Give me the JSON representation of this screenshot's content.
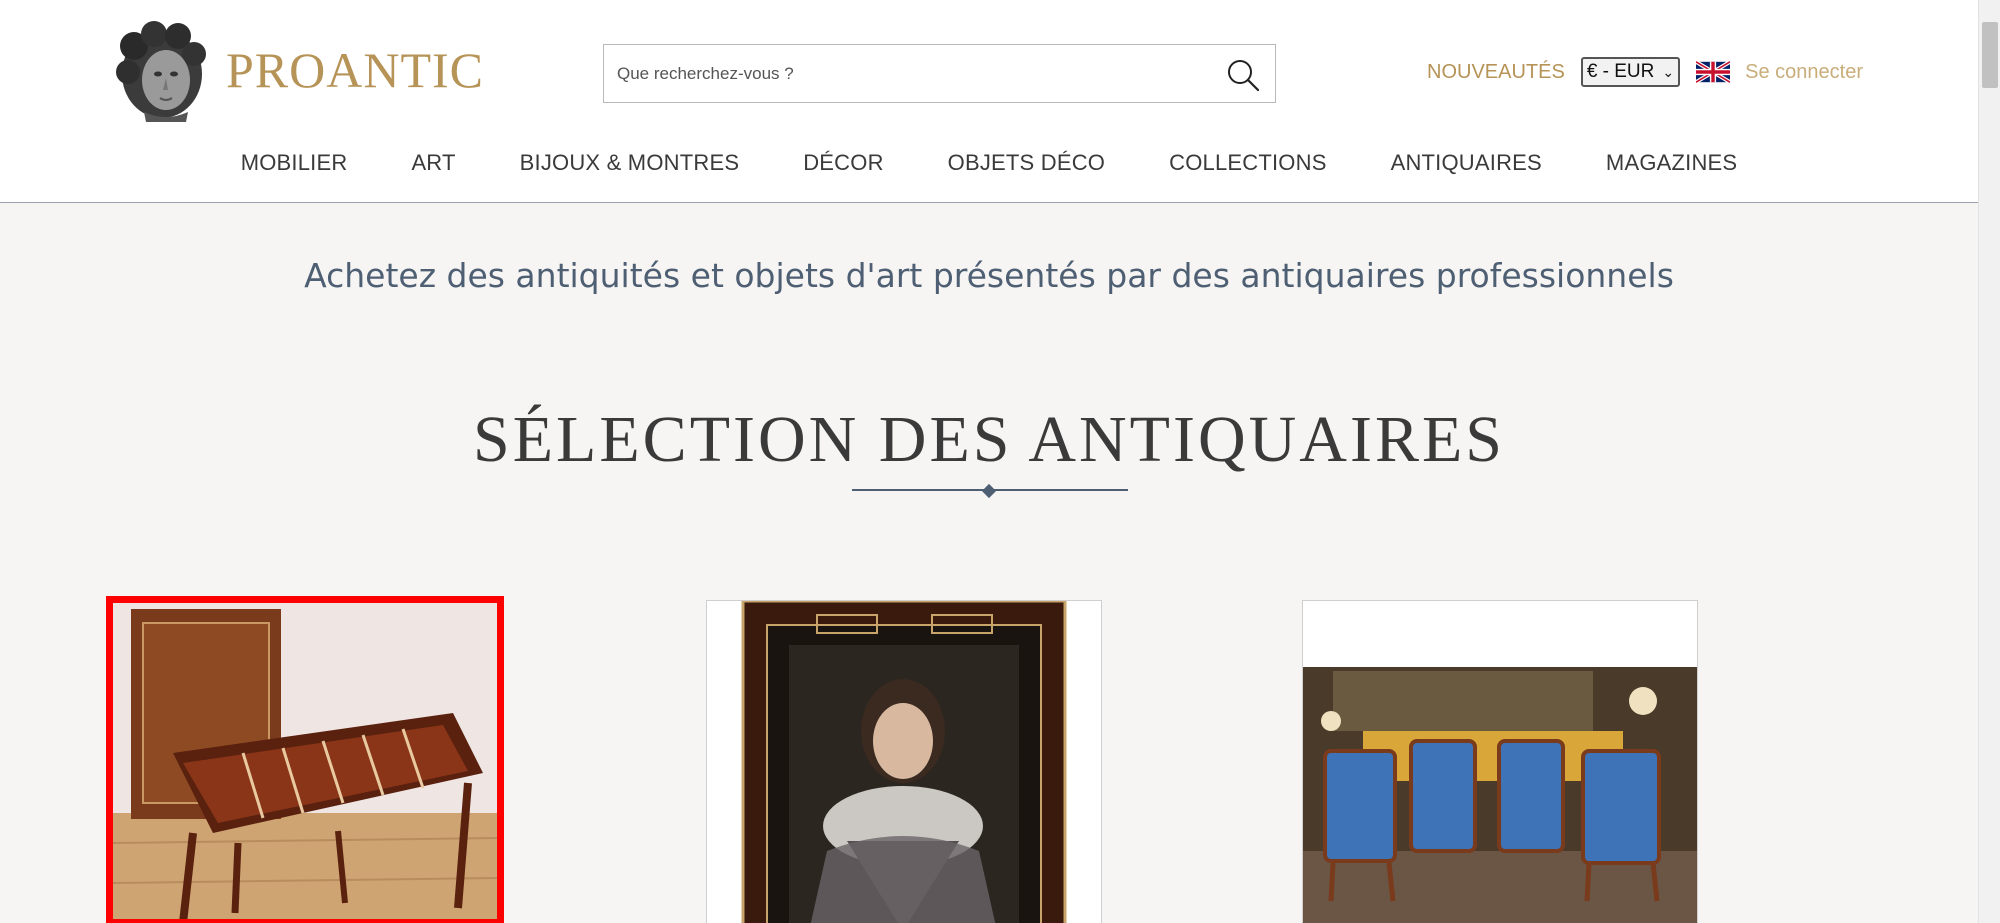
{
  "header": {
    "logo_text": "PROANTIC",
    "search": {
      "placeholder": "Que recherchez-vous ?"
    },
    "nouveautes_label": "NOUVEAUTÉS",
    "currency": {
      "selected": "€ - EUR"
    },
    "language_flag": "uk-flag-icon",
    "login_label": "Se connecter",
    "nav": [
      {
        "label": "MOBILIER"
      },
      {
        "label": "ART"
      },
      {
        "label": "BIJOUX & MONTRES"
      },
      {
        "label": "DÉCOR"
      },
      {
        "label": "OBJETS DÉCO"
      },
      {
        "label": "COLLECTIONS"
      },
      {
        "label": "ANTIQUAIRES"
      },
      {
        "label": "MAGAZINES"
      }
    ]
  },
  "main": {
    "tagline": "Achetez des antiquités et objets d'art présentés par des antiquaires professionnels",
    "section_title": "SÉLECTION DES ANTIQUAIRES",
    "products": [
      {
        "image": "backgammon-game-table-image",
        "selected": true
      },
      {
        "image": "portrait-painting-image",
        "selected": false
      },
      {
        "image": "armchairs-salon-image",
        "selected": false
      }
    ]
  },
  "colors": {
    "brand_gold": "#b69356",
    "text_slate": "#4e5f73",
    "selection_red": "#ff0000",
    "page_background": "#f6f5f3"
  }
}
